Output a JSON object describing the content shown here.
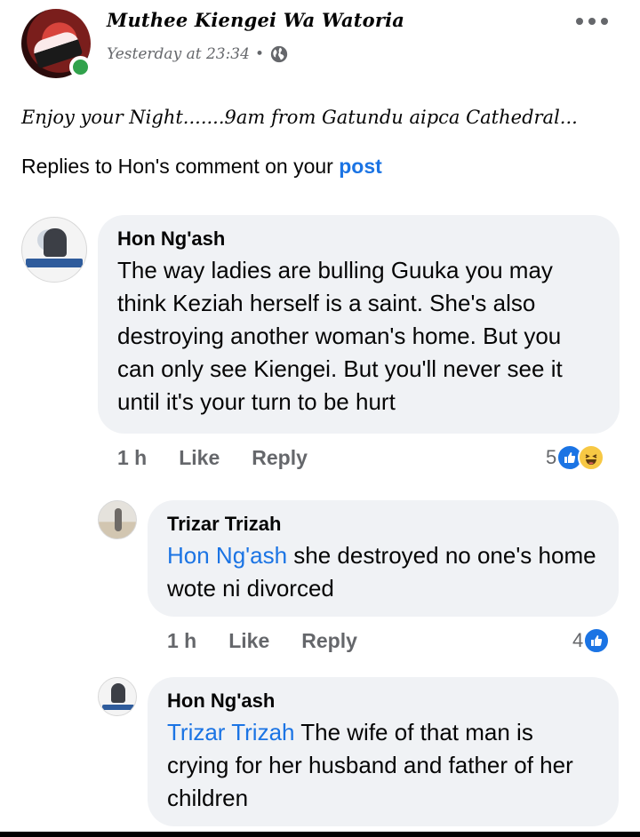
{
  "post": {
    "author": "Muthee Kiengei Wa Watoria",
    "time": "Yesterday at 23:34",
    "separator": "•",
    "audience_icon": "globe-icon",
    "text": "Enjoy your Night.......9am from Gatundu aipca Cathedral..."
  },
  "banner": {
    "prefix": "Replies to Hon's comment on your ",
    "link": "post"
  },
  "comments": [
    {
      "author": "Hon Ng'ash",
      "text": "The way ladies are bulling Guuka you may think Keziah herself is a saint. She's also destroying another woman's home. But you can only see Kiengei. But you'll never see it until it's your turn to be hurt",
      "time": "1 h",
      "like": "Like",
      "reply": "Reply",
      "reaction_count": "5",
      "reactions": [
        "like-icon",
        "haha-icon"
      ]
    },
    {
      "author": "Trizar Trizah",
      "mention": "Hon Ng'ash",
      "text": " she destroyed no one's home wote ni divorced",
      "time": "1 h",
      "like": "Like",
      "reply": "Reply",
      "reaction_count": "4",
      "reactions": [
        "like-icon"
      ]
    },
    {
      "author": "Hon Ng'ash",
      "mention": "Trizar Trizah",
      "text": " The wife of that man is crying for her husband and father of her children"
    }
  ],
  "colors": {
    "link": "#1b74e4",
    "bubble": "#f0f2f5",
    "meta": "#65676b",
    "online": "#31a24c"
  }
}
